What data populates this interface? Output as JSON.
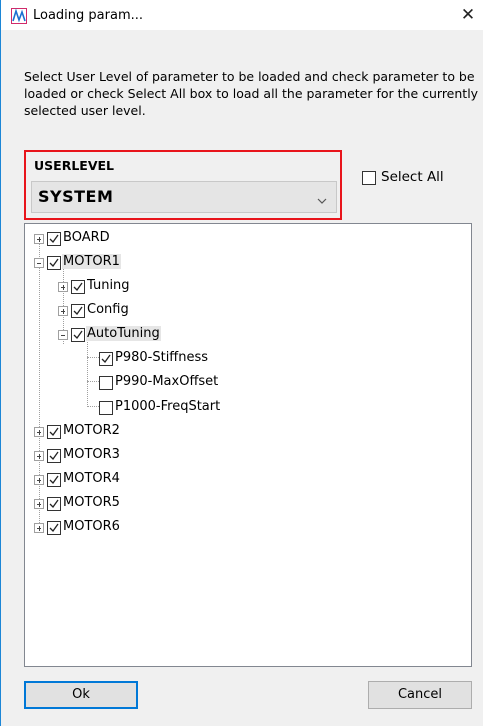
{
  "window": {
    "title": "Loading param...",
    "close_glyph": "✕"
  },
  "description": "Select User Level of parameter to be loaded and check parameter to be loaded or check Select All box to load all the parameter for the currently selected user level.",
  "userlevel": {
    "label": "USERLEVEL",
    "value": "SYSTEM"
  },
  "select_all": {
    "label": "Select All",
    "checked": false
  },
  "tree": {
    "board": "BOARD",
    "motor1": "MOTOR1",
    "tuning": "Tuning",
    "config": "Config",
    "autotuning": "AutoTuning",
    "p980": "P980-Stiffness",
    "p990": "P990-MaxOffset",
    "p1000": "P1000-FreqStart",
    "motor2": "MOTOR2",
    "motor3": "MOTOR3",
    "motor4": "MOTOR4",
    "motor5": "MOTOR5",
    "motor6": "MOTOR6"
  },
  "buttons": {
    "ok": "Ok",
    "cancel": "Cancel"
  },
  "colors": {
    "highlight_border": "#e8141b",
    "accent": "#0078d7"
  }
}
